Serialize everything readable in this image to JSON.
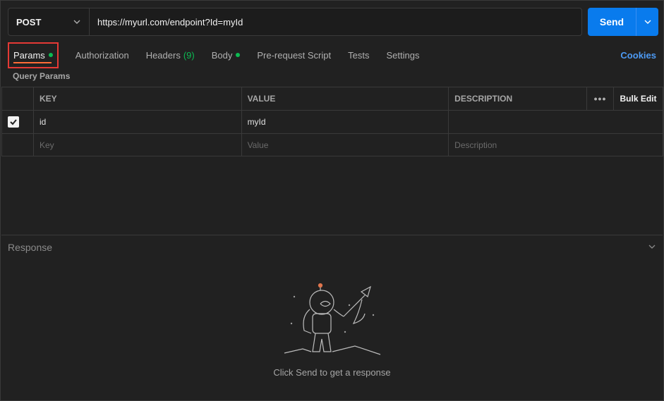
{
  "request": {
    "method": "POST",
    "url": "https://myurl.com/endpoint?Id=myId",
    "send_label": "Send"
  },
  "tabs": [
    {
      "label": "Params",
      "indicator": "dot"
    },
    {
      "label": "Authorization"
    },
    {
      "label": "Headers",
      "count": "(9)"
    },
    {
      "label": "Body",
      "indicator": "dot"
    },
    {
      "label": "Pre-request Script"
    },
    {
      "label": "Tests"
    },
    {
      "label": "Settings"
    }
  ],
  "cookies_label": "Cookies",
  "params": {
    "section_label": "Query Params",
    "headers": {
      "key": "KEY",
      "value": "VALUE",
      "description": "DESCRIPTION",
      "more": "•••",
      "bulk_edit": "Bulk Edit"
    },
    "rows": [
      {
        "checked": true,
        "key": "id",
        "value": "myId",
        "description": ""
      }
    ],
    "placeholders": {
      "key": "Key",
      "value": "Value",
      "description": "Description"
    }
  },
  "response": {
    "label": "Response",
    "empty_text": "Click Send to get a response"
  },
  "colors": {
    "accent": "#097bed",
    "active_underline": "#ff6c37",
    "indicator": "#0cbb52",
    "link": "#4d9bf5",
    "highlight_box": "#e53935"
  }
}
